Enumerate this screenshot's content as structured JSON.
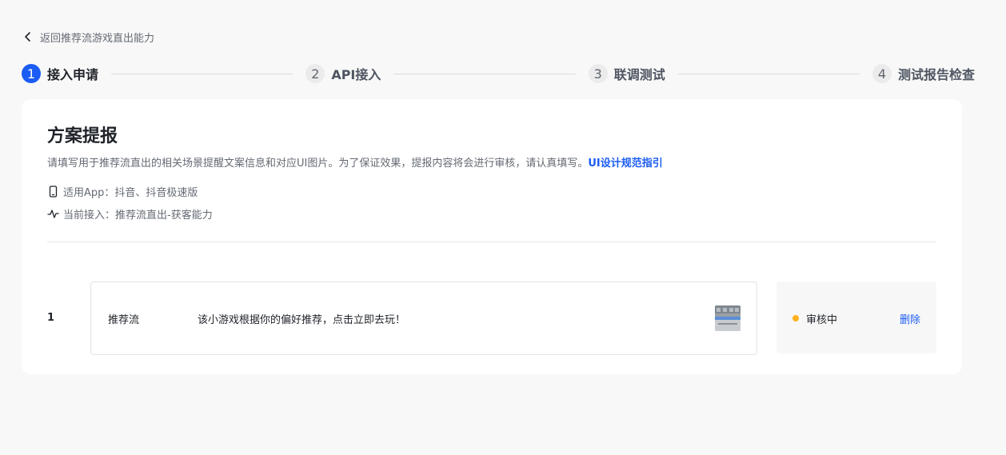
{
  "back_link": {
    "label": "返回推荐流游戏直出能力"
  },
  "steps": [
    {
      "number": "1",
      "label": "接入申请",
      "state": "active"
    },
    {
      "number": "2",
      "label": "API接入",
      "state": "pending"
    },
    {
      "number": "3",
      "label": "联调测试",
      "state": "pending"
    },
    {
      "number": "4",
      "label": "测试报告检查",
      "state": "pending"
    }
  ],
  "card": {
    "title": "方案提报",
    "description": "请填写用于推荐流直出的相关场景提醒文案信息和对应UI图片。为了保证效果，提报内容将会进行审核，请认真填写。",
    "guide_link": "UI设计规范指引",
    "applicable_apps": "适用App：抖音、抖音极速版",
    "current_access": "当前接入：推荐流直出-获客能力"
  },
  "rows": [
    {
      "index": "1",
      "scene": "推荐流",
      "copy_text": "该小游戏根据你的偏好推荐，点击立即去玩！",
      "thumbnail_icon": "image-thumbnail",
      "status": "审核中",
      "status_color": "#ffb21e",
      "action": "删除"
    }
  ],
  "colors": {
    "accent": "#1b5cf4",
    "page_background": "#f8f8f8",
    "card_background": "#ffffff"
  }
}
